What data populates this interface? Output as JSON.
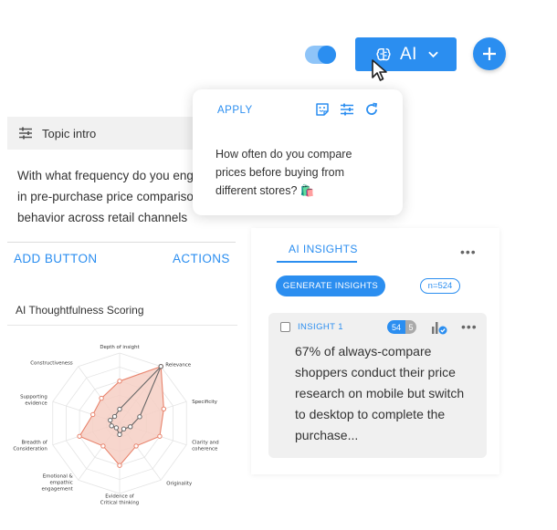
{
  "header": {
    "ai_label": "AI",
    "toggle_on": true
  },
  "topic": {
    "label": "Topic intro",
    "question_lines": [
      "With what frequency do you eng",
      "in pre-purchase price compariso",
      "behavior across retail channels"
    ]
  },
  "actions": {
    "add_button": "ADD BUTTON",
    "actions": "ACTIONS"
  },
  "scoring": {
    "title": "AI Thoughtfulness Scoring"
  },
  "chart_data": {
    "type": "radar",
    "axes": [
      "Depth of insight",
      "Relevance",
      "Specificity",
      "Clarity and coherence",
      "Originality",
      "Evidence of Critical thinking",
      "Emotional & empathic engagement",
      "Breadth of Consideration",
      "Supporting evidence",
      "Constructiveness"
    ],
    "rmax": 5,
    "series": [
      {
        "values": [
          3,
          5,
          3.3,
          3,
          2,
          3,
          2,
          3,
          2,
          2.2
        ],
        "color": "#e8836c",
        "fill": "#f6cfc4"
      },
      {
        "values": [
          1,
          5,
          1.5,
          0.8,
          0.5,
          0.8,
          0.4,
          0.6,
          0.7,
          0.6
        ],
        "color": "#666666",
        "fill": "none"
      }
    ]
  },
  "popup": {
    "apply": "APPLY",
    "lines": [
      "How often do you compare",
      "prices before buying from",
      "different stores? 🛍️"
    ]
  },
  "insights": {
    "tab": "AI INSIGHTS",
    "generate": "GENERATE INSIGHTS",
    "count": "n=524",
    "card": {
      "title": "INSIGHT 1",
      "votes_up": "54",
      "votes_down": "5",
      "lines": [
        "67% of always-compare",
        "shoppers conduct their price",
        "research on mobile but switch",
        "to desktop to complete the",
        "purchase..."
      ]
    }
  },
  "colors": {
    "accent": "#2b8ef0",
    "radar_fill": "#f6cfc4",
    "radar_stroke": "#e8836c"
  }
}
